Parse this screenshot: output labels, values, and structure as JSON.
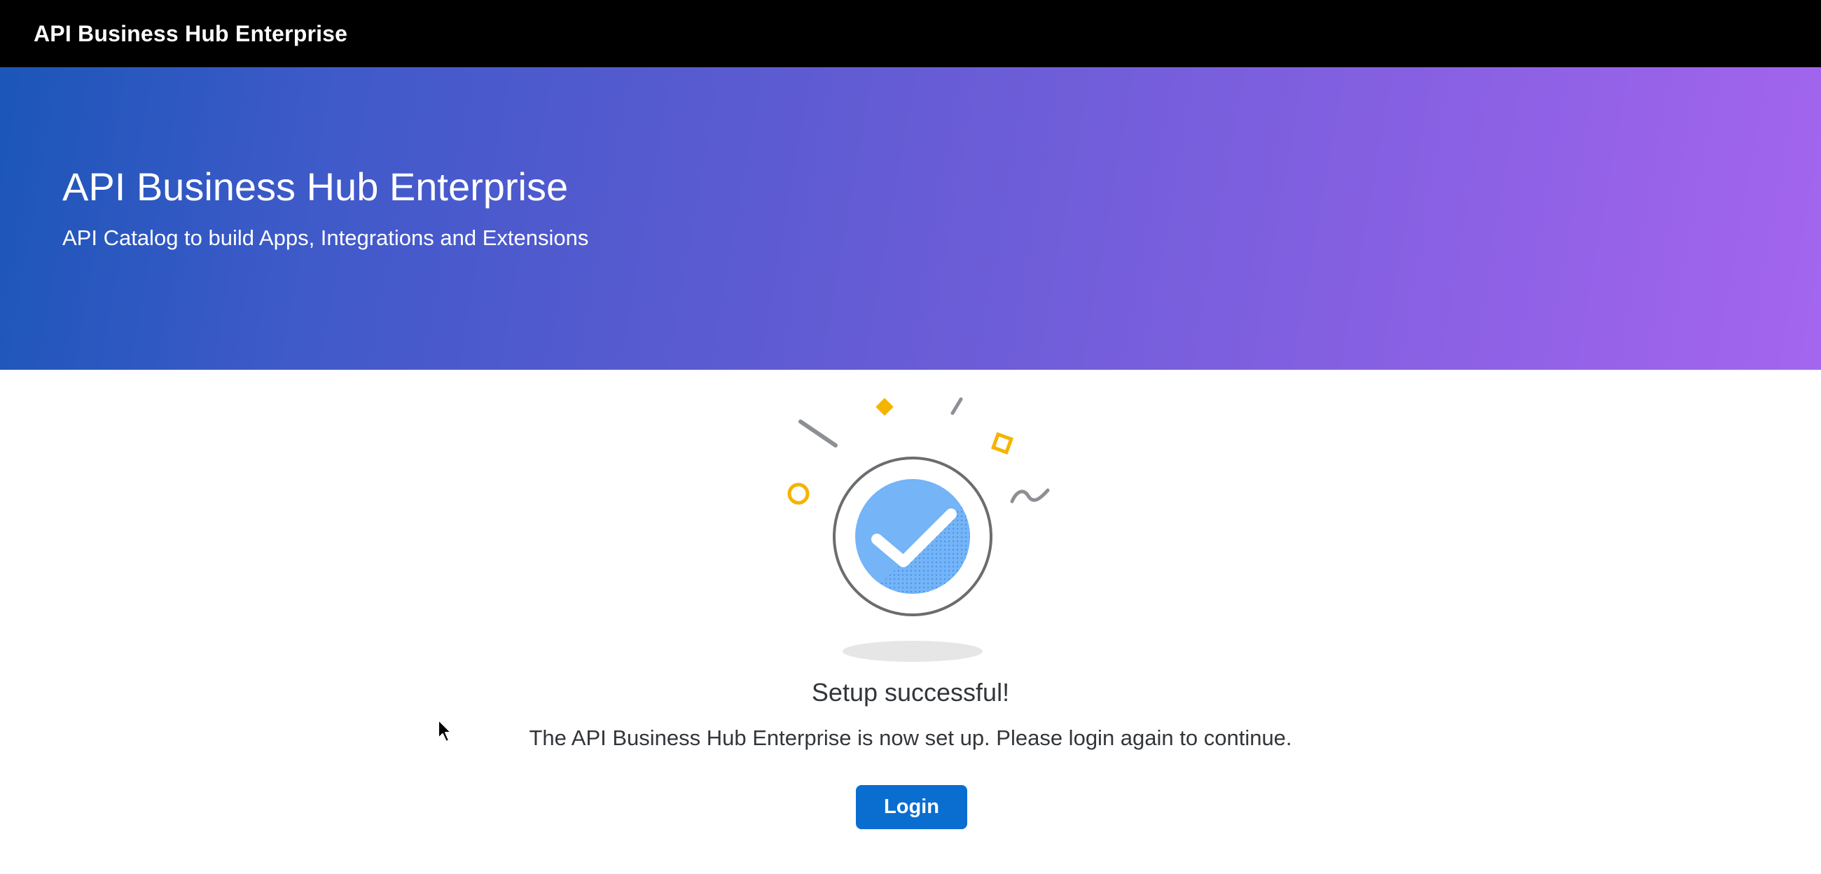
{
  "shellbar": {
    "title": "API Business Hub Enterprise"
  },
  "hero": {
    "title": "API Business Hub Enterprise",
    "subtitle": "API Catalog to build Apps, Integrations and Extensions"
  },
  "message": {
    "icon": "success-checkmark-illustration",
    "title": "Setup successful!",
    "text": "The API Business Hub Enterprise is now set up. Please login again to continue."
  },
  "actions": {
    "login_label": "Login"
  },
  "colors": {
    "shellbar_bg": "#000000",
    "hero_gradient_start": "#1b56b8",
    "hero_gradient_end": "#a466ee",
    "button_bg": "#0a6ed1",
    "check_fill": "#74b4f7"
  }
}
